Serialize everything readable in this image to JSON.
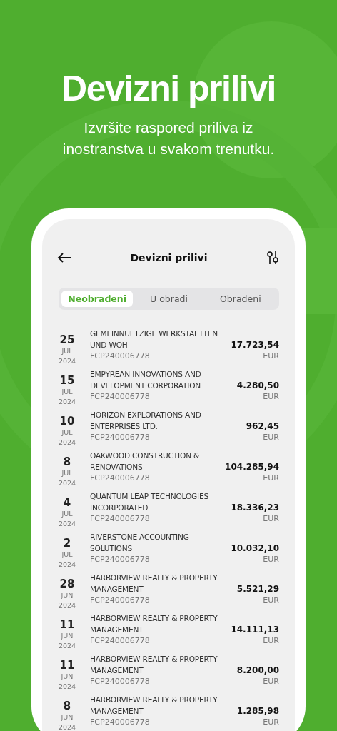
{
  "headline": "Devizni prilivi",
  "subtitle": "Izvršite raspored priliva iz inostranstva u svakom trenutku.",
  "screen": {
    "title": "Devizni prilivi",
    "tabs": [
      {
        "label": "Neobrađeni",
        "selected": true
      },
      {
        "label": "U obradi",
        "selected": false
      },
      {
        "label": "Obrađeni",
        "selected": false
      }
    ],
    "rows": [
      {
        "day": "25",
        "month": "JUL",
        "year": "2024",
        "name": "GEMEINNUETZIGE WERKSTAETTEN UND WOH",
        "reference": "FCP240006778",
        "amount": "17.723,54",
        "currency": "EUR"
      },
      {
        "day": "15",
        "month": "JUL",
        "year": "2024",
        "name": "EMPYREAN INNOVATIONS AND DEVELOPMENT CORPORATION",
        "reference": "FCP240006778",
        "amount": "4.280,50",
        "currency": "EUR"
      },
      {
        "day": "10",
        "month": "JUL",
        "year": "2024",
        "name": "HORIZON EXPLORATIONS AND ENTERPRISES LTD.",
        "reference": "FCP240006778",
        "amount": "962,45",
        "currency": "EUR"
      },
      {
        "day": "8",
        "month": "JUL",
        "year": "2024",
        "name": "OAKWOOD CONSTRUCTION & RENOVATIONS",
        "reference": "FCP240006778",
        "amount": "104.285,94",
        "currency": "EUR"
      },
      {
        "day": "4",
        "month": "JUL",
        "year": "2024",
        "name": "QUANTUM LEAP TECHNOLOGIES INCORPORATED",
        "reference": "FCP240006778",
        "amount": "18.336,23",
        "currency": "EUR"
      },
      {
        "day": "2",
        "month": "JUL",
        "year": "2024",
        "name": "RIVERSTONE ACCOUNTING SOLUTIONS",
        "reference": "FCP240006778",
        "amount": "10.032,10",
        "currency": "EUR"
      },
      {
        "day": "28",
        "month": "JUN",
        "year": "2024",
        "name": "HARBORVIEW REALTY & PROPERTY MANAGEMENT",
        "reference": "FCP240006778",
        "amount": "5.521,29",
        "currency": "EUR"
      },
      {
        "day": "11",
        "month": "JUN",
        "year": "2024",
        "name": "HARBORVIEW REALTY & PROPERTY MANAGEMENT",
        "reference": "FCP240006778",
        "amount": "14.111,13",
        "currency": "EUR"
      },
      {
        "day": "11",
        "month": "JUN",
        "year": "2024",
        "name": "HARBORVIEW REALTY & PROPERTY MANAGEMENT",
        "reference": "FCP240006778",
        "amount": "8.200,00",
        "currency": "EUR"
      },
      {
        "day": "8",
        "month": "JUN",
        "year": "2024",
        "name": "HARBORVIEW REALTY & PROPERTY MANAGEMENT",
        "reference": "FCP240006778",
        "amount": "1.285,98",
        "currency": "EUR"
      }
    ]
  }
}
